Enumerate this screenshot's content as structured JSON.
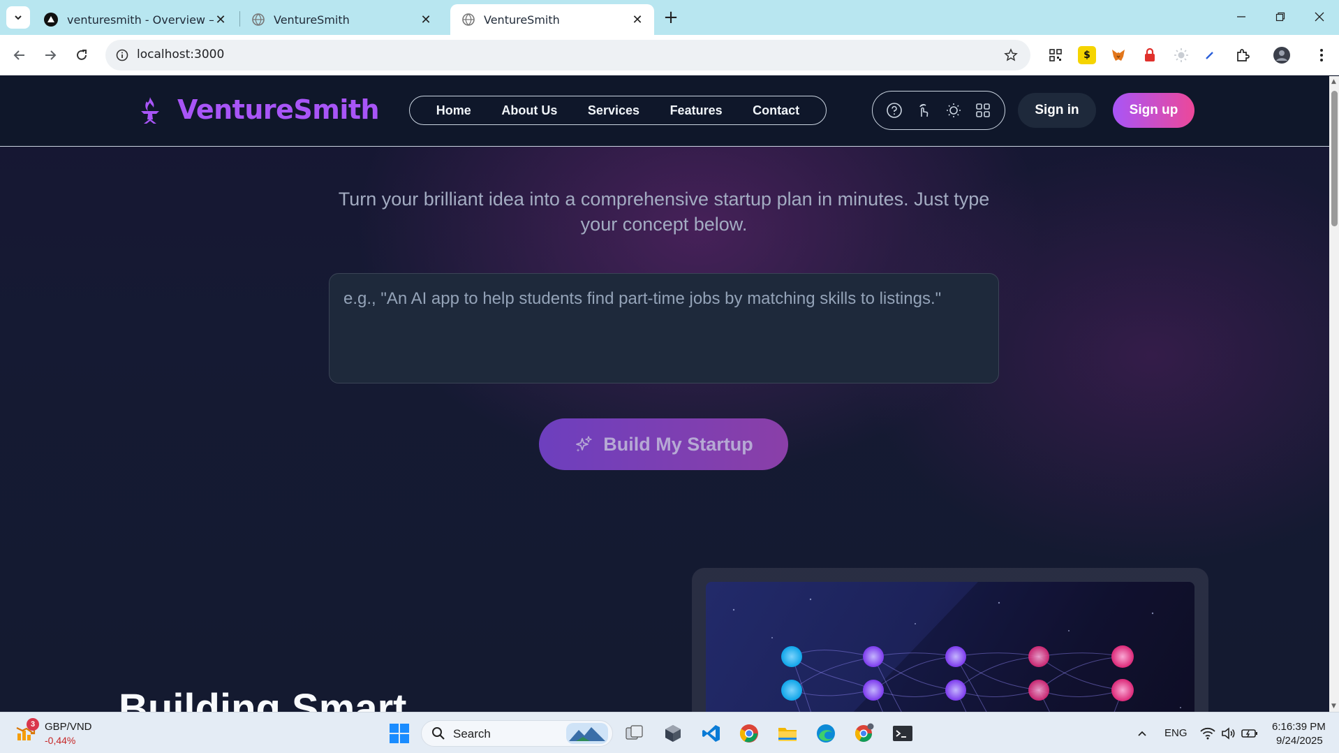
{
  "browser": {
    "tabs": [
      {
        "title": "venturesmith - Overview – Verc",
        "active": false
      },
      {
        "title": "VentureSmith",
        "active": false
      },
      {
        "title": "VentureSmith",
        "active": true
      }
    ],
    "url": "localhost:3000"
  },
  "site": {
    "brand": "VentureSmith",
    "nav": [
      "Home",
      "About Us",
      "Services",
      "Features",
      "Contact"
    ],
    "sign_in": "Sign in",
    "sign_up": "Sign up",
    "tagline": "Turn your brilliant idea into a comprehensive startup plan in minutes. Just type your concept below.",
    "idea_placeholder": "e.g., \"An AI app to help students find part-time jobs by matching skills to listings.\"",
    "build_button": "Build My Startup",
    "hero_heading_partial": "Building Smart",
    "colors": {
      "brand": "#a855f7",
      "accent_pink": "#ec4899",
      "header_bg": "#0f172a"
    }
  },
  "taskbar": {
    "ticker_badge": "3",
    "ticker_pair": "GBP/VND",
    "ticker_change": "-0,44%",
    "search_label": "Search",
    "language": "ENG",
    "time": "6:16:39 PM",
    "date": "9/24/2025"
  }
}
